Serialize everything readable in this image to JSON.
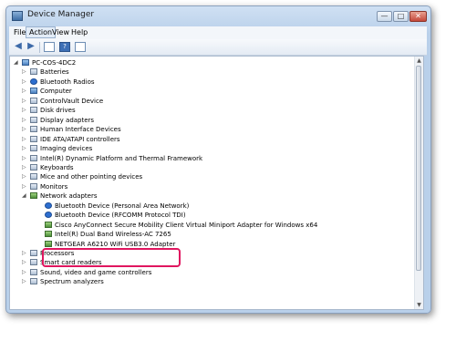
{
  "window": {
    "title": "Device Manager"
  },
  "menu": {
    "items": [
      "File",
      "Action",
      "View",
      "Help"
    ]
  },
  "tree": {
    "root": "PC-COS-4DC2",
    "categories": [
      "Batteries",
      "Bluetooth Radios",
      "Computer",
      "ControlVault Device",
      "Disk drives",
      "Display adapters",
      "Human Interface Devices",
      "IDE ATA/ATAPI controllers",
      "Imaging devices",
      "Intel(R) Dynamic Platform and Thermal Framework",
      "Keyboards",
      "Mice and other pointing devices",
      "Monitors",
      "Network adapters"
    ],
    "network_children": [
      "Bluetooth Device (Personal Area Network)",
      "Bluetooth Device (RFCOMM Protocol TDI)",
      "Cisco AnyConnect Secure Mobility Client Virtual Miniport Adapter for Windows x64",
      "Intel(R) Dual Band Wireless-AC 7265",
      "NETGEAR A6210 WiFi USB3.0 Adapter"
    ],
    "after": [
      "Processors",
      "Smart card readers",
      "Sound, video and game controllers",
      "Spectrum analyzers"
    ]
  },
  "colors": {
    "highlight": "#e0165f"
  }
}
